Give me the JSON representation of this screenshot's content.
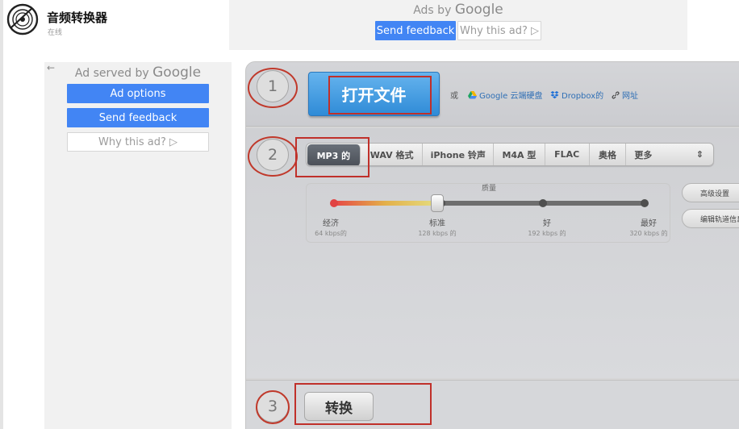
{
  "header": {
    "title": "音频转换器",
    "subtitle": "在线",
    "logo_icon": "vinyl-disc-icon"
  },
  "top_ad": {
    "ads_by": "Ads by",
    "google": "Google",
    "send_feedback": "Send feedback",
    "why_this_ad": "Why this ad? ▷"
  },
  "left_ad": {
    "back": "←",
    "served_by": "Ad served by",
    "google": "Google",
    "ad_options": "Ad options",
    "send_feedback": "Send feedback",
    "why_this_ad": "Why this ad? ▷"
  },
  "steps": {
    "one": "1",
    "two": "2",
    "three": "3"
  },
  "open": {
    "button": "打开文件",
    "or": "或",
    "google_drive": "Google 云端硬盘",
    "dropbox": "Dropbox的",
    "url": "网址"
  },
  "formats": {
    "tabs": [
      {
        "label": "MP3 的",
        "active": true
      },
      {
        "label": "WAV 格式",
        "active": false
      },
      {
        "label": "iPhone 铃声",
        "active": false
      },
      {
        "label": "M4A 型",
        "active": false
      },
      {
        "label": "FLAC",
        "active": false
      },
      {
        "label": "奥格",
        "active": false
      },
      {
        "label": "更多",
        "active": false
      }
    ],
    "more_arrow": "⇕"
  },
  "quality": {
    "label": "质量",
    "selected_index": 1,
    "levels": [
      {
        "name": "经济",
        "kbps": "64 kbps的"
      },
      {
        "name": "标准",
        "kbps": "128 kbps 的"
      },
      {
        "name": "好",
        "kbps": "192 kbps 的"
      },
      {
        "name": "最好",
        "kbps": "320 kbps 的"
      }
    ]
  },
  "side": {
    "advanced": "高级设置",
    "edit_tracks": "编辑轨道信息"
  },
  "convert": {
    "button": "转换"
  },
  "colors": {
    "accent_blue": "#4285f4",
    "open_button": "#3b96de",
    "annotation_red": "#c0302a",
    "active_tab": "#565b63"
  }
}
